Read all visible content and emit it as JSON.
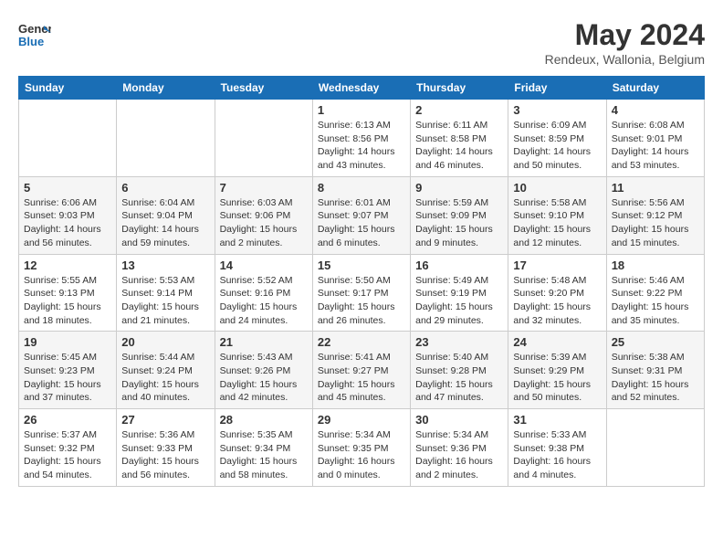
{
  "logo": {
    "line1": "General",
    "line2": "Blue"
  },
  "header": {
    "month_year": "May 2024",
    "location": "Rendeux, Wallonia, Belgium"
  },
  "days_of_week": [
    "Sunday",
    "Monday",
    "Tuesday",
    "Wednesday",
    "Thursday",
    "Friday",
    "Saturday"
  ],
  "weeks": [
    [
      {
        "day": "",
        "info": ""
      },
      {
        "day": "",
        "info": ""
      },
      {
        "day": "",
        "info": ""
      },
      {
        "day": "1",
        "info": "Sunrise: 6:13 AM\nSunset: 8:56 PM\nDaylight: 14 hours\nand 43 minutes."
      },
      {
        "day": "2",
        "info": "Sunrise: 6:11 AM\nSunset: 8:58 PM\nDaylight: 14 hours\nand 46 minutes."
      },
      {
        "day": "3",
        "info": "Sunrise: 6:09 AM\nSunset: 8:59 PM\nDaylight: 14 hours\nand 50 minutes."
      },
      {
        "day": "4",
        "info": "Sunrise: 6:08 AM\nSunset: 9:01 PM\nDaylight: 14 hours\nand 53 minutes."
      }
    ],
    [
      {
        "day": "5",
        "info": "Sunrise: 6:06 AM\nSunset: 9:03 PM\nDaylight: 14 hours\nand 56 minutes."
      },
      {
        "day": "6",
        "info": "Sunrise: 6:04 AM\nSunset: 9:04 PM\nDaylight: 14 hours\nand 59 minutes."
      },
      {
        "day": "7",
        "info": "Sunrise: 6:03 AM\nSunset: 9:06 PM\nDaylight: 15 hours\nand 2 minutes."
      },
      {
        "day": "8",
        "info": "Sunrise: 6:01 AM\nSunset: 9:07 PM\nDaylight: 15 hours\nand 6 minutes."
      },
      {
        "day": "9",
        "info": "Sunrise: 5:59 AM\nSunset: 9:09 PM\nDaylight: 15 hours\nand 9 minutes."
      },
      {
        "day": "10",
        "info": "Sunrise: 5:58 AM\nSunset: 9:10 PM\nDaylight: 15 hours\nand 12 minutes."
      },
      {
        "day": "11",
        "info": "Sunrise: 5:56 AM\nSunset: 9:12 PM\nDaylight: 15 hours\nand 15 minutes."
      }
    ],
    [
      {
        "day": "12",
        "info": "Sunrise: 5:55 AM\nSunset: 9:13 PM\nDaylight: 15 hours\nand 18 minutes."
      },
      {
        "day": "13",
        "info": "Sunrise: 5:53 AM\nSunset: 9:14 PM\nDaylight: 15 hours\nand 21 minutes."
      },
      {
        "day": "14",
        "info": "Sunrise: 5:52 AM\nSunset: 9:16 PM\nDaylight: 15 hours\nand 24 minutes."
      },
      {
        "day": "15",
        "info": "Sunrise: 5:50 AM\nSunset: 9:17 PM\nDaylight: 15 hours\nand 26 minutes."
      },
      {
        "day": "16",
        "info": "Sunrise: 5:49 AM\nSunset: 9:19 PM\nDaylight: 15 hours\nand 29 minutes."
      },
      {
        "day": "17",
        "info": "Sunrise: 5:48 AM\nSunset: 9:20 PM\nDaylight: 15 hours\nand 32 minutes."
      },
      {
        "day": "18",
        "info": "Sunrise: 5:46 AM\nSunset: 9:22 PM\nDaylight: 15 hours\nand 35 minutes."
      }
    ],
    [
      {
        "day": "19",
        "info": "Sunrise: 5:45 AM\nSunset: 9:23 PM\nDaylight: 15 hours\nand 37 minutes."
      },
      {
        "day": "20",
        "info": "Sunrise: 5:44 AM\nSunset: 9:24 PM\nDaylight: 15 hours\nand 40 minutes."
      },
      {
        "day": "21",
        "info": "Sunrise: 5:43 AM\nSunset: 9:26 PM\nDaylight: 15 hours\nand 42 minutes."
      },
      {
        "day": "22",
        "info": "Sunrise: 5:41 AM\nSunset: 9:27 PM\nDaylight: 15 hours\nand 45 minutes."
      },
      {
        "day": "23",
        "info": "Sunrise: 5:40 AM\nSunset: 9:28 PM\nDaylight: 15 hours\nand 47 minutes."
      },
      {
        "day": "24",
        "info": "Sunrise: 5:39 AM\nSunset: 9:29 PM\nDaylight: 15 hours\nand 50 minutes."
      },
      {
        "day": "25",
        "info": "Sunrise: 5:38 AM\nSunset: 9:31 PM\nDaylight: 15 hours\nand 52 minutes."
      }
    ],
    [
      {
        "day": "26",
        "info": "Sunrise: 5:37 AM\nSunset: 9:32 PM\nDaylight: 15 hours\nand 54 minutes."
      },
      {
        "day": "27",
        "info": "Sunrise: 5:36 AM\nSunset: 9:33 PM\nDaylight: 15 hours\nand 56 minutes."
      },
      {
        "day": "28",
        "info": "Sunrise: 5:35 AM\nSunset: 9:34 PM\nDaylight: 15 hours\nand 58 minutes."
      },
      {
        "day": "29",
        "info": "Sunrise: 5:34 AM\nSunset: 9:35 PM\nDaylight: 16 hours\nand 0 minutes."
      },
      {
        "day": "30",
        "info": "Sunrise: 5:34 AM\nSunset: 9:36 PM\nDaylight: 16 hours\nand 2 minutes."
      },
      {
        "day": "31",
        "info": "Sunrise: 5:33 AM\nSunset: 9:38 PM\nDaylight: 16 hours\nand 4 minutes."
      },
      {
        "day": "",
        "info": ""
      }
    ]
  ]
}
